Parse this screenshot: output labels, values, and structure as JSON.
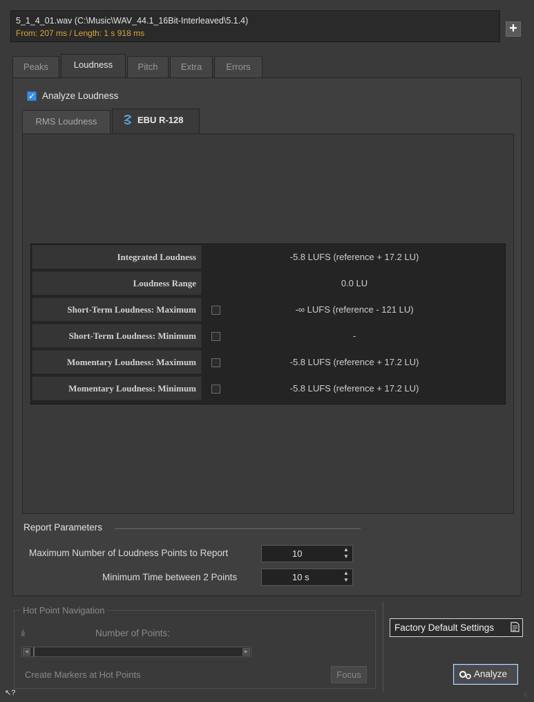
{
  "file": {
    "name": "5_1_4_01.wav (C:\\Music\\WAV_44.1_16Bit-Interleaved\\5.1.4)",
    "range": "From: 207 ms / Length: 1 s 918 ms"
  },
  "tabs": [
    {
      "label": "Peaks"
    },
    {
      "label": "Loudness",
      "active": true
    },
    {
      "label": "Pitch"
    },
    {
      "label": "Extra"
    },
    {
      "label": "Errors"
    }
  ],
  "analyze_loudness": {
    "label": "Analyze Loudness",
    "checked": true
  },
  "subtabs": [
    {
      "label": "RMS Loudness"
    },
    {
      "label": "EBU R-128",
      "active": true
    }
  ],
  "results": [
    {
      "label": "Integrated Loudness",
      "value": "-5.8 LUFS (reference + 17.2 LU)",
      "has_checkbox": false
    },
    {
      "label": "Loudness Range",
      "value": "0.0 LU",
      "has_checkbox": false
    },
    {
      "label": "Short-Term Loudness: Maximum",
      "value": "-∞ LUFS (reference - 121 LU)",
      "has_checkbox": true
    },
    {
      "label": "Short-Term Loudness: Minimum",
      "value": "-",
      "has_checkbox": true
    },
    {
      "label": "Momentary Loudness: Maximum",
      "value": "-5.8 LUFS (reference + 17.2 LU)",
      "has_checkbox": true
    },
    {
      "label": "Momentary Loudness: Minimum",
      "value": "-5.8 LUFS (reference + 17.2 LU)",
      "has_checkbox": true
    }
  ],
  "report": {
    "title": "Report Parameters",
    "max_points_label": "Maximum Number of Loudness Points to Report",
    "max_points_value": "10",
    "min_time_label": "Minimum Time between 2 Points",
    "min_time_value": "10 s"
  },
  "hot_points": {
    "title": "Hot Point Navigation",
    "points_label": "Number of Points:",
    "markers_label": "Create Markers at Hot Points",
    "focus_label": "Focus"
  },
  "buttons": {
    "factory": "Factory Default Settings",
    "analyze": "Analyze",
    "add": "+"
  },
  "colors": {
    "accent": "#3c8ee0",
    "range_text": "#d8a63c"
  }
}
